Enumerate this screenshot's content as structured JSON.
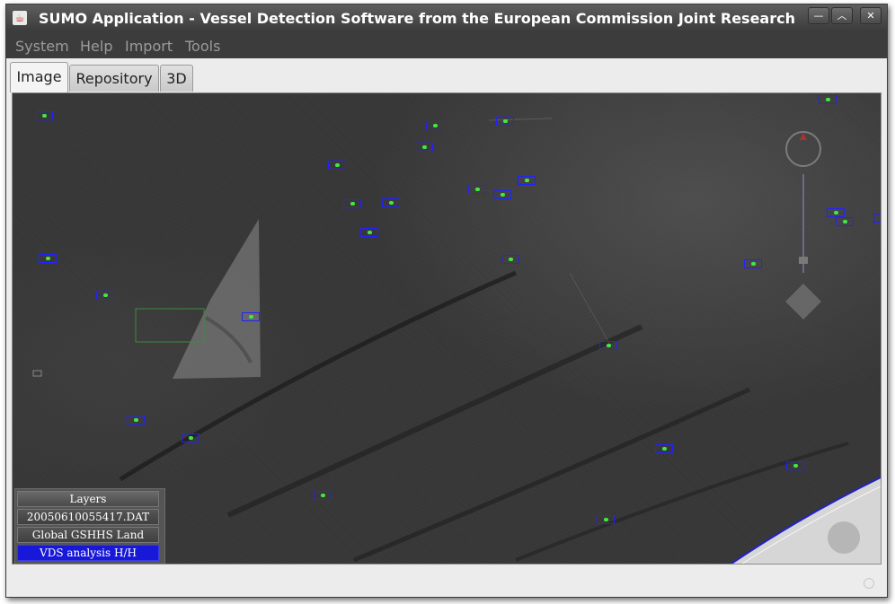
{
  "window": {
    "title": "SUMO Application - Vessel Detection Software from the European Commission Joint Research",
    "icon": "java-cup-icon",
    "controls": [
      "minimize-icon",
      "maximize-icon",
      "close-icon"
    ]
  },
  "menubar": {
    "items": [
      "System",
      "Help",
      "Import",
      "Tools"
    ]
  },
  "tabs": [
    {
      "label": "Image",
      "active": true
    },
    {
      "label": "Repository",
      "active": false
    },
    {
      "label": "3D",
      "active": false
    }
  ],
  "viewer": {
    "detection_color": "#2222ff",
    "target_color": "#41e841",
    "detections_count": 33
  },
  "layers": {
    "title": "Layers",
    "items": [
      {
        "label": "20050610055417.DAT",
        "selected": false
      },
      {
        "label": "Global GSHHS Land Mask",
        "selected": false
      },
      {
        "label": "VDS analysis H/H",
        "selected": true
      }
    ]
  },
  "colors": {
    "selected_layer": "#1818d8",
    "land_mask_outline": "#2222cc"
  }
}
